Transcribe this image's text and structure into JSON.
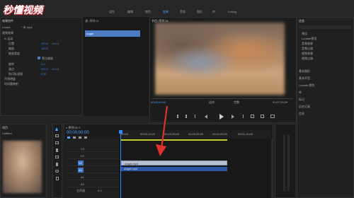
{
  "watermark": "秒懂视频",
  "menubar": {
    "tabs": [
      "组件",
      "编辑",
      "颜色",
      "效果",
      "音频",
      "图形",
      "库",
      "Editing"
    ]
  },
  "effect_controls": {
    "header": "效果控件",
    "clip": "Lowell",
    "clip_name": "* 未.mp4",
    "section": "视频效果",
    "motion": "fx 运动",
    "position": "位置",
    "position_vals": [
      "200.0",
      "144.0"
    ],
    "scale": "缩放",
    "scale_val": "100.0",
    "scale_width": "缩放宽度",
    "uniform": "等比缩放",
    "rotation": "旋转",
    "rotation_val": "0.0",
    "anchor": "锚点",
    "anchor_vals": [
      "200.0",
      "144.0"
    ],
    "anti_flicker": "防闪烁滤镜",
    "anti_val": "0.00",
    "opacity": "不透明度",
    "time_remap": "时间重映射"
  },
  "source_panel": {
    "header": "源: 序列 01",
    "clip_label": "Angel"
  },
  "program": {
    "header": "节目: 序列 01",
    "timecode_left": "00;00;00;00",
    "fit": "适合",
    "ratio": "完整",
    "timecode_right": "00;07;28;29"
  },
  "right_panel": {
    "header": "信息",
    "items": [
      "预设",
      "Lumetri预设",
      "音频效果",
      "音频过渡",
      "视频效果",
      "视频过渡"
    ],
    "sections": [
      "基本图形",
      "基本声音",
      "Lumetri 颜色",
      "库",
      "标记",
      "历史记录",
      "信息"
    ]
  },
  "project": {
    "header": "项目",
    "name": "Untitled"
  },
  "timeline": {
    "timecode": "00;00;00;00",
    "ruler_labels": [
      "00;00",
      "00;00;15;00",
      "00;00;30;00",
      "00;00;45;00",
      "00;01;00;00",
      "00;01;15;00"
    ],
    "tracks": [
      "V3",
      "V2",
      "V1",
      "A1",
      "A2",
      "A3"
    ],
    "clip_video_label": "Angel.mp4",
    "clip_audio_label": "Angel.mp4",
    "master": "主声道",
    "master_val": "0.0"
  },
  "colors": {
    "accent": "#2f8cff",
    "clip_video": "#b8bfd1",
    "clip_audio": "#2c57a6",
    "arrow": "#e0322e"
  }
}
